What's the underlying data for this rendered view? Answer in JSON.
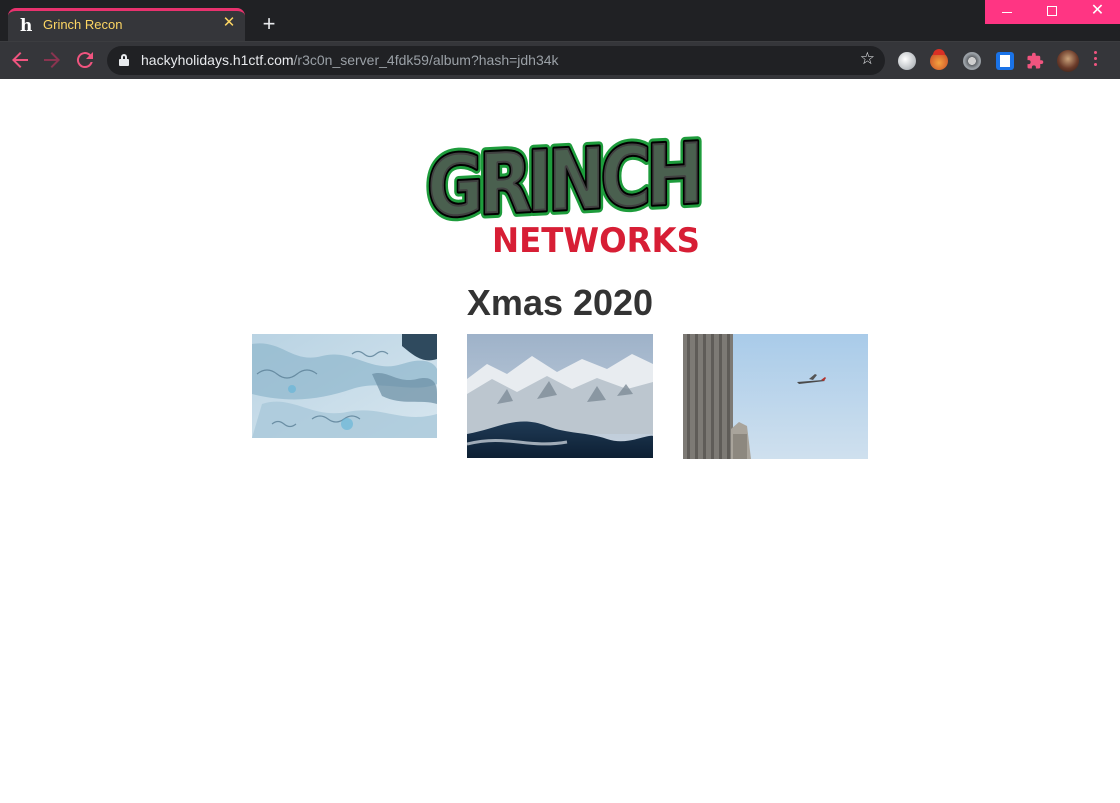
{
  "browser": {
    "tab": {
      "title": "Grinch Recon",
      "close_label": "✕",
      "favicon": "h"
    },
    "new_tab_label": "+",
    "address_bar": {
      "url_host": "hackyholidays.h1ctf.com",
      "url_path": "/r3c0n_server_4fdk59/album?hash=jdh34k"
    },
    "icons": {
      "back": "arrow-left-icon",
      "forward": "arrow-right-icon",
      "reload": "reload-icon",
      "lock": "lock-icon",
      "star": "star-icon",
      "extensions": "puzzle-icon",
      "menu": "kebab-menu-icon"
    },
    "accent_color": "#ff3583"
  },
  "page": {
    "logo": {
      "line1": "GRINCH",
      "line2": "NETWORKS"
    },
    "album_title": "Xmas 2020",
    "photos": [
      {
        "subject": "aerial view of sea ice"
      },
      {
        "subject": "snowy mountains from above"
      },
      {
        "subject": "airplane in blue sky beside a building"
      }
    ]
  },
  "colors": {
    "logo_green": "#1e9c3c",
    "logo_red": "#d71e35",
    "title_text": "#333333"
  }
}
